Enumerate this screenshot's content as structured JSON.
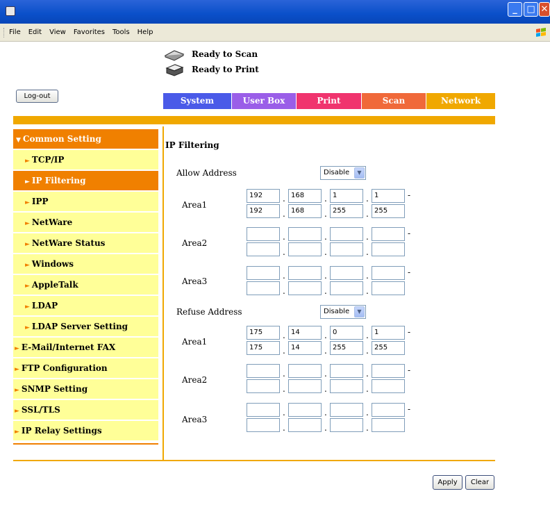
{
  "menu": [
    "File",
    "Edit",
    "View",
    "Favorites",
    "Tools",
    "Help"
  ],
  "status": {
    "scan": "Ready to Scan",
    "print": "Ready to Print"
  },
  "logout_label": "Log-out",
  "tabs": {
    "system": "System",
    "userbox": "User Box",
    "print": "Print",
    "scan": "Scan",
    "network": "Network"
  },
  "colors": {
    "accent_orange": "#f0a800",
    "sidebar_bg": "#ffff98",
    "sidebar_active": "#f08000"
  },
  "sidebar": {
    "header": "Common Setting",
    "items": [
      "TCP/IP",
      "IP Filtering",
      "IPP",
      "NetWare",
      "NetWare Status",
      "Windows",
      "AppleTalk",
      "LDAP",
      "LDAP Server Setting",
      "E-Mail/Internet FAX",
      "FTP Configuration",
      "SNMP Setting",
      "SSL/TLS",
      "IP Relay Settings"
    ]
  },
  "form": {
    "title": "IP Filtering",
    "allow": {
      "label": "Allow Address",
      "select": "Disable",
      "areas": [
        {
          "label": "Area1",
          "from": [
            "192",
            "168",
            "1",
            "1"
          ],
          "to": [
            "192",
            "168",
            "255",
            "255"
          ]
        },
        {
          "label": "Area2",
          "from": [
            "",
            "",
            "",
            ""
          ],
          "to": [
            "",
            "",
            "",
            ""
          ]
        },
        {
          "label": "Area3",
          "from": [
            "",
            "",
            "",
            ""
          ],
          "to": [
            "",
            "",
            "",
            ""
          ]
        }
      ]
    },
    "refuse": {
      "label": "Refuse Address",
      "select": "Disable",
      "areas": [
        {
          "label": "Area1",
          "from": [
            "175",
            "14",
            "0",
            "1"
          ],
          "to": [
            "175",
            "14",
            "255",
            "255"
          ]
        },
        {
          "label": "Area2",
          "from": [
            "",
            "",
            "",
            ""
          ],
          "to": [
            "",
            "",
            "",
            ""
          ]
        },
        {
          "label": "Area3",
          "from": [
            "",
            "",
            "",
            ""
          ],
          "to": [
            "",
            "",
            "",
            ""
          ]
        }
      ]
    }
  },
  "buttons": {
    "apply": "Apply",
    "clear": "Clear"
  }
}
